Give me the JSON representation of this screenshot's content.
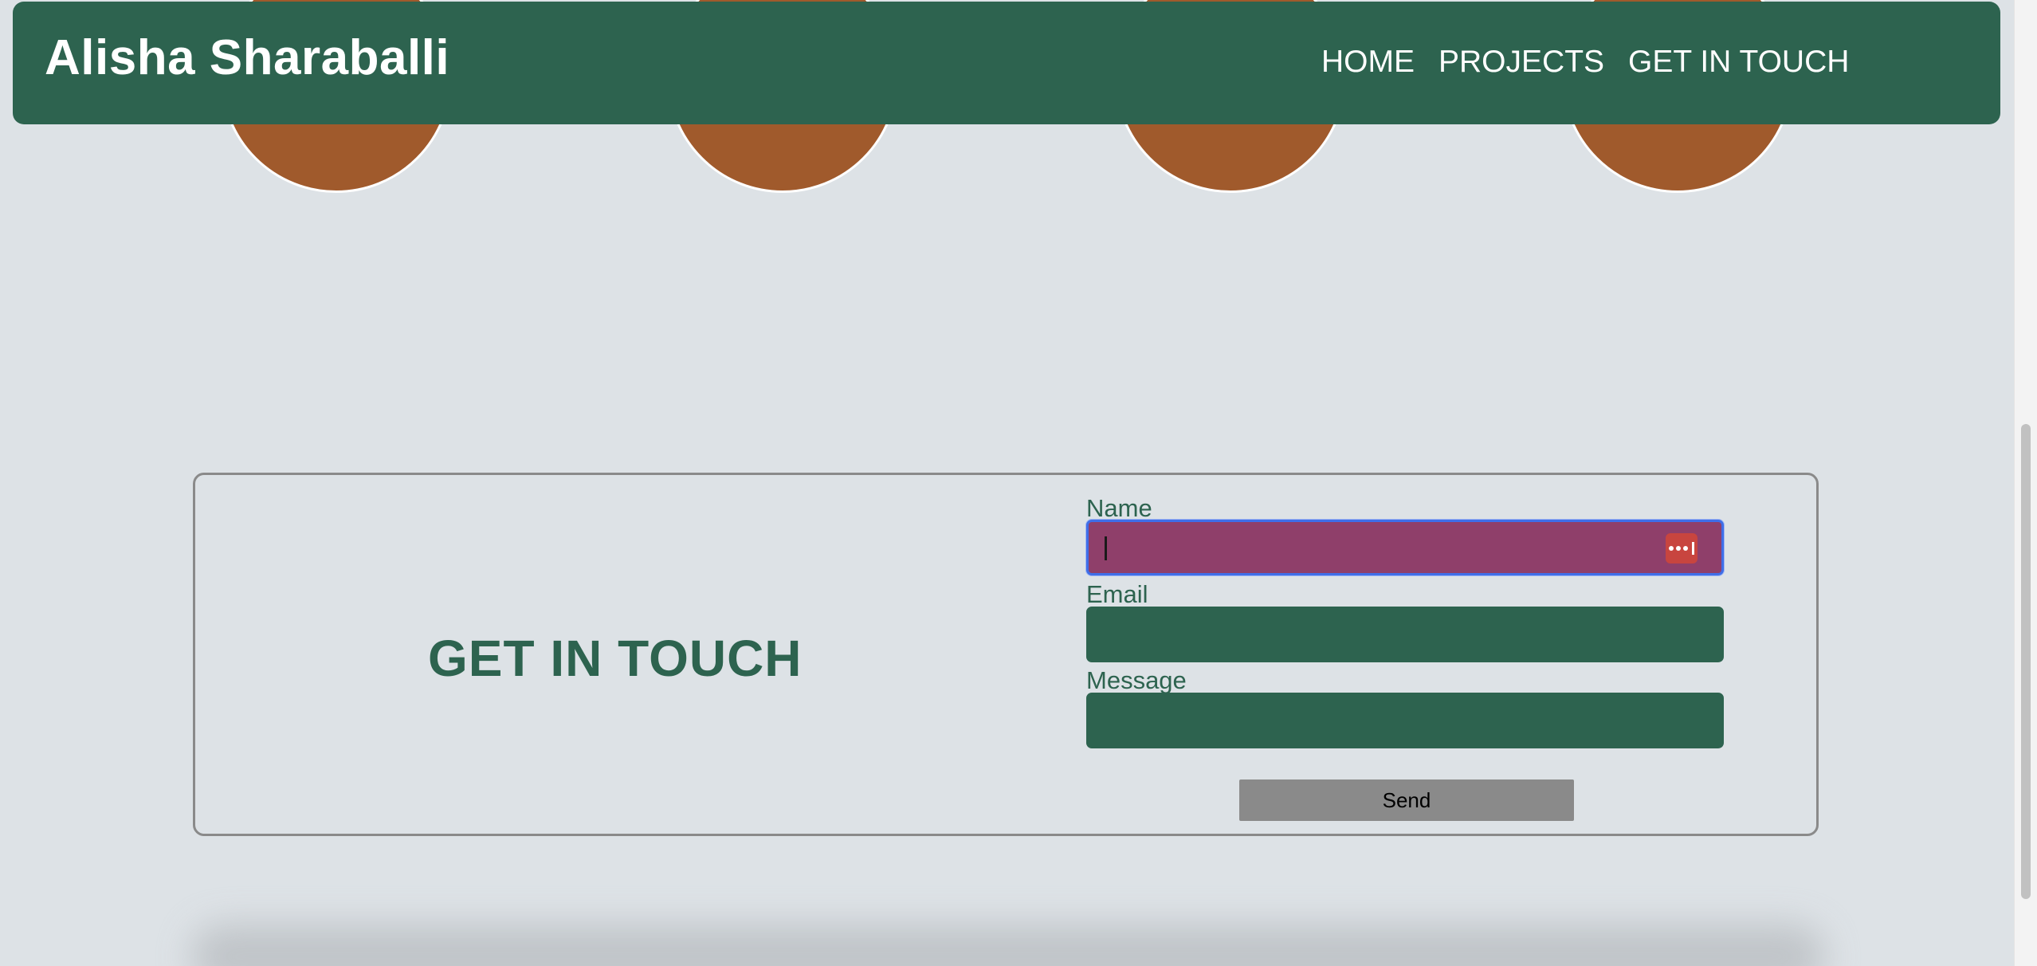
{
  "navbar": {
    "brand": "Alisha Sharaballi",
    "links": [
      "HOME",
      "PROJECTS",
      "GET IN TOUCH"
    ]
  },
  "contact": {
    "heading": "GET IN TOUCH",
    "fields": [
      {
        "label": "Name",
        "value": "",
        "focused": true
      },
      {
        "label": "Email",
        "value": ""
      },
      {
        "label": "Message",
        "value": ""
      }
    ],
    "send_label": "Send"
  },
  "colors": {
    "primary_green": "#2d634f",
    "page_background": "#dde2e6",
    "avatar_orange": "#a05a2c",
    "focused_input": "#8f3f6a",
    "password_icon": "#c8453f",
    "button_gray": "#8a8a8a"
  },
  "icons": [
    "password-manager-icon"
  ]
}
